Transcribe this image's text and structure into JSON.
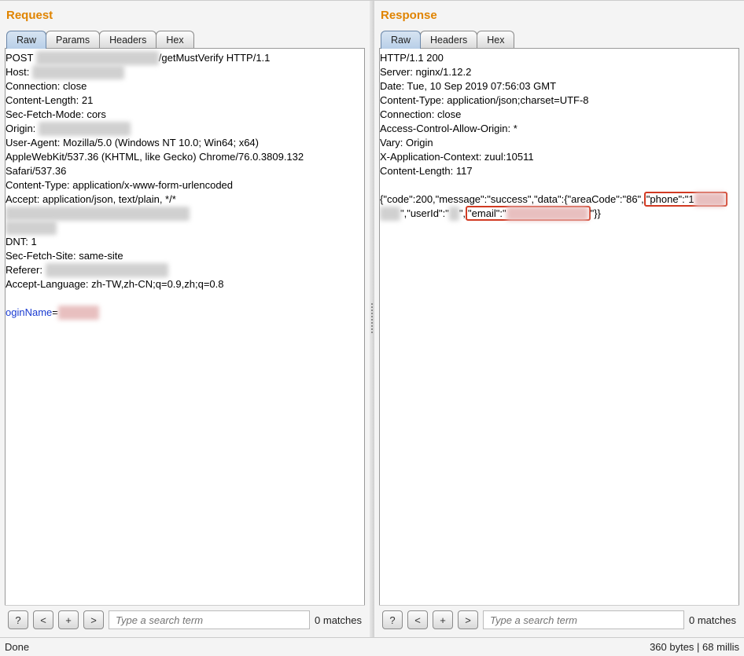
{
  "request": {
    "title": "Request",
    "tabs": {
      "raw": "Raw",
      "params": "Params",
      "headers": "Headers",
      "hex": "Hex"
    },
    "http_line_pre": "POST ",
    "http_line_post": "/getMustVerify HTTP/1.1",
    "header_host_label": "Host: ",
    "header_conn": "Connection: close",
    "header_clen": "Content-Length: 21",
    "header_sfm": "Sec-Fetch-Mode: cors",
    "header_origin_label": "Origin: ",
    "header_ua1": "User-Agent: Mozilla/5.0 (Windows NT 10.0; Win64; x64)",
    "header_ua2": "AppleWebKit/537.36 (KHTML, like Gecko) Chrome/76.0.3809.132",
    "header_ua3": "Safari/537.36",
    "header_ct": "Content-Type: application/x-www-form-urlencoded",
    "header_accept": "Accept: application/json, text/plain, */*",
    "header_dnt": "DNT: 1",
    "header_sfs": "Sec-Fetch-Site: same-site",
    "header_ref_label": "Referer: ",
    "header_al": "Accept-Language: zh-TW,zh-CN;q=0.9,zh;q=0.8",
    "body_param": "oginName",
    "body_eq": "=",
    "search": {
      "placeholder": "Type a search term",
      "matches": "0 matches"
    }
  },
  "response": {
    "title": "Response",
    "tabs": {
      "raw": "Raw",
      "headers": "Headers",
      "hex": "Hex"
    },
    "status": "HTTP/1.1 200",
    "h_server": "Server: nginx/1.12.2",
    "h_date": "Date: Tue, 10 Sep 2019 07:56:03 GMT",
    "h_ct": "Content-Type: application/json;charset=UTF-8",
    "h_conn": "Connection: close",
    "h_acao": "Access-Control-Allow-Origin: *",
    "h_vary": "Vary: Origin",
    "h_xac": "X-Application-Context: zuul:10511",
    "h_clen": "Content-Length: 117",
    "json_seg1": "{\"code\":200,\"message\":\"success\",\"data\":{\"areaCode\":\"86\",",
    "json_phone_lbl": "\"phone\":\"1",
    "json_seg2_a": "\",\"userId\":\"",
    "json_seg2_b": "\",",
    "json_email_lbl": "\"email\":\"",
    "json_seg3": "\"}}",
    "search": {
      "placeholder": "Type a search term",
      "matches": "0 matches"
    }
  },
  "buttons": {
    "help": "?",
    "prev": "<",
    "add": "+",
    "next": ">"
  },
  "status": {
    "left": "Done",
    "right": "360 bytes | 68 millis"
  }
}
